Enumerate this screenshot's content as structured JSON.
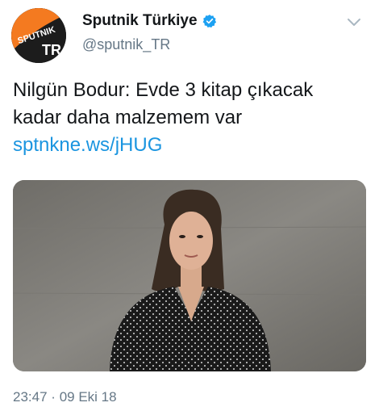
{
  "author": {
    "display_name": "Sputnik Türkiye",
    "handle": "@sputnik_TR",
    "avatar_logo_text": "SPUTNIK",
    "avatar_badge_text": "TR",
    "verified": true
  },
  "tweet": {
    "text_line1": "Nilgün Bodur: Evde 3 kitap çıkacak",
    "text_line2": "kadar daha malzemem var",
    "link": "sptnkne.ws/jHUG"
  },
  "meta": {
    "time": "23:47",
    "separator": "·",
    "date": "09 Eki 18"
  },
  "colors": {
    "link": "#1b95e0",
    "verified": "#1da1f2",
    "avatar_orange": "#f47a20",
    "secondary_text": "#657786"
  },
  "icons": {
    "verified": "verified-badge-icon",
    "more": "chevron-down-icon"
  }
}
